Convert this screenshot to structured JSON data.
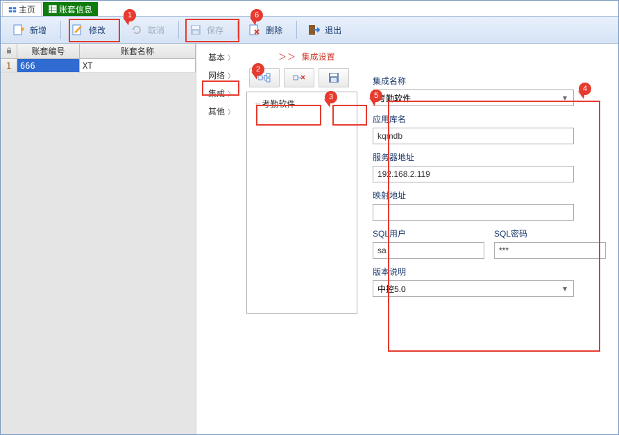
{
  "tabs": {
    "home": "主页",
    "info": "账套信息"
  },
  "toolbar": {
    "new": "新增",
    "edit": "修改",
    "cancel": "取消",
    "save": "保存",
    "delete": "删除",
    "exit": "退出"
  },
  "grid": {
    "headers": {
      "code": "账套编号",
      "name": "账套名称"
    },
    "row": {
      "idx": "1",
      "code": "666",
      "name": "XT"
    }
  },
  "nav": {
    "basic": "基本",
    "network": "网络",
    "integration": "集成",
    "other": "其他"
  },
  "panel": {
    "title_prefix": "＞＞",
    "title": "集成设置"
  },
  "tree": {
    "node1": "考勤软件"
  },
  "form": {
    "integration_name": {
      "label": "集成名称",
      "value": "考勤软件"
    },
    "db_name": {
      "label": "应用库名",
      "value": "kqmdb"
    },
    "server_addr": {
      "label": "服务器地址",
      "value": "192.168.2.119"
    },
    "map_addr": {
      "label": "映射地址",
      "value": ""
    },
    "sql_user": {
      "label": "SQL用户",
      "value": "sa"
    },
    "sql_pwd": {
      "label": "SQL密码",
      "value": "***"
    },
    "version": {
      "label": "版本说明",
      "value": "中控5.0"
    }
  },
  "callouts": {
    "c1": "1",
    "c2": "2",
    "c3": "3",
    "c4": "4",
    "c5": "5",
    "c6": "6"
  }
}
